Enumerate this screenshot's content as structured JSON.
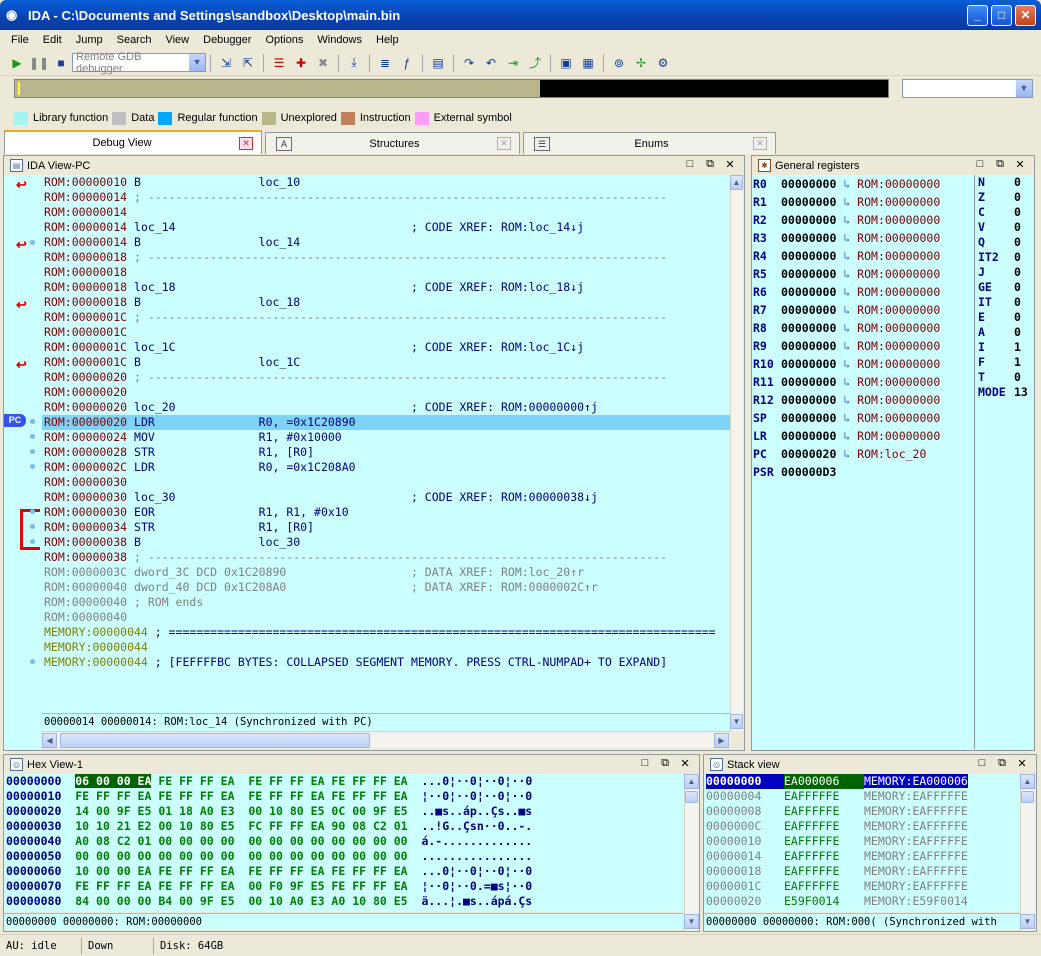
{
  "window": {
    "title": "IDA - C:\\Documents and Settings\\sandbox\\Desktop\\main.bin"
  },
  "menu": [
    "File",
    "Edit",
    "Jump",
    "Search",
    "View",
    "Debugger",
    "Options",
    "Windows",
    "Help"
  ],
  "toolbar": {
    "debugger_combo": "Remote GDB debugger"
  },
  "legend": [
    {
      "label": "Library function",
      "color": "#a6f3f3"
    },
    {
      "label": "Data",
      "color": "#c0c0c0"
    },
    {
      "label": "Regular function",
      "color": "#00a8ff"
    },
    {
      "label": "Unexplored",
      "color": "#b8b68a"
    },
    {
      "label": "Instruction",
      "color": "#c0805a"
    },
    {
      "label": "External symbol",
      "color": "#ff9cf5"
    }
  ],
  "tabs": [
    {
      "label": "Debug View"
    },
    {
      "label": "Structures"
    },
    {
      "label": "Enums"
    }
  ],
  "ida_view": {
    "title": "IDA View-PC",
    "pc_label": "PC",
    "sync_text": "00000014 00000014: ROM:loc_14 (Synchronized with PC)",
    "lines": [
      {
        "addr": "ROM:00000010",
        "text": " B                 loc_10",
        "kind": "code"
      },
      {
        "addr": "ROM:00000014",
        "text": " ; ---------------------------------------------------------------------------",
        "kind": "sep"
      },
      {
        "addr": "ROM:00000014",
        "text": "",
        "kind": "code"
      },
      {
        "addr": "ROM:00000014",
        "text": " loc_14                                  ; CODE XREF: ROM:loc_14↓j",
        "kind": "label"
      },
      {
        "addr": "ROM:00000014",
        "text": " B                 loc_14",
        "kind": "code"
      },
      {
        "addr": "ROM:00000018",
        "text": " ; ---------------------------------------------------------------------------",
        "kind": "sep"
      },
      {
        "addr": "ROM:00000018",
        "text": "",
        "kind": "code"
      },
      {
        "addr": "ROM:00000018",
        "text": " loc_18                                  ; CODE XREF: ROM:loc_18↓j",
        "kind": "label"
      },
      {
        "addr": "ROM:00000018",
        "text": " B                 loc_18",
        "kind": "code"
      },
      {
        "addr": "ROM:0000001C",
        "text": " ; ---------------------------------------------------------------------------",
        "kind": "sep"
      },
      {
        "addr": "ROM:0000001C",
        "text": "",
        "kind": "code"
      },
      {
        "addr": "ROM:0000001C",
        "text": " loc_1C                                  ; CODE XREF: ROM:loc_1C↓j",
        "kind": "label"
      },
      {
        "addr": "ROM:0000001C",
        "text": " B                 loc_1C",
        "kind": "code"
      },
      {
        "addr": "ROM:00000020",
        "text": " ; ---------------------------------------------------------------------------",
        "kind": "sep"
      },
      {
        "addr": "ROM:00000020",
        "text": "",
        "kind": "code"
      },
      {
        "addr": "ROM:00000020",
        "text": " loc_20                                  ; CODE XREF: ROM:00000000↑j",
        "kind": "label"
      },
      {
        "addr": "ROM:00000020",
        "text": " LDR               R0, =0x1C20890",
        "kind": "hl"
      },
      {
        "addr": "ROM:00000024",
        "text": " MOV               R1, #0x10000",
        "kind": "code"
      },
      {
        "addr": "ROM:00000028",
        "text": " STR               R1, [R0]",
        "kind": "code"
      },
      {
        "addr": "ROM:0000002C",
        "text": " LDR               R0, =0x1C208A0",
        "kind": "code"
      },
      {
        "addr": "ROM:00000030",
        "text": "",
        "kind": "code"
      },
      {
        "addr": "ROM:00000030",
        "text": " loc_30                                  ; CODE XREF: ROM:00000038↓j",
        "kind": "label"
      },
      {
        "addr": "ROM:00000030",
        "text": " EOR               R1, R1, #0x10",
        "kind": "code"
      },
      {
        "addr": "ROM:00000034",
        "text": " STR               R1, [R0]",
        "kind": "code"
      },
      {
        "addr": "ROM:00000038",
        "text": " B                 loc_30",
        "kind": "code"
      },
      {
        "addr": "ROM:00000038",
        "text": " ; ---------------------------------------------------------------------------",
        "kind": "sep"
      },
      {
        "addr": "ROM:0000003C",
        "text": " dword_3C DCD 0x1C20890                  ; DATA XREF: ROM:loc_20↑r",
        "kind": "data"
      },
      {
        "addr": "ROM:00000040",
        "text": " dword_40 DCD 0x1C208A0                  ; DATA XREF: ROM:0000002C↑r",
        "kind": "data"
      },
      {
        "addr": "ROM:00000040",
        "text": " ; ROM ends",
        "kind": "data"
      },
      {
        "addr": "ROM:00000040",
        "text": "",
        "kind": "data"
      },
      {
        "addr": "MEMORY:00000044",
        "text": " ; ===============================================================================",
        "kind": "mem"
      },
      {
        "addr": "MEMORY:00000044",
        "text": "",
        "kind": "mem"
      },
      {
        "addr": "MEMORY:00000044",
        "text": " ; [FEFFFFBC BYTES: COLLAPSED SEGMENT MEMORY. PRESS CTRL-NUMPAD+ TO EXPAND]",
        "kind": "mem"
      }
    ]
  },
  "registers": {
    "title": "General registers",
    "rows": [
      {
        "name": "R0",
        "value": "00000000",
        "target": "ROM:00000000"
      },
      {
        "name": "R1",
        "value": "00000000",
        "target": "ROM:00000000"
      },
      {
        "name": "R2",
        "value": "00000000",
        "target": "ROM:00000000"
      },
      {
        "name": "R3",
        "value": "00000000",
        "target": "ROM:00000000"
      },
      {
        "name": "R4",
        "value": "00000000",
        "target": "ROM:00000000"
      },
      {
        "name": "R5",
        "value": "00000000",
        "target": "ROM:00000000"
      },
      {
        "name": "R6",
        "value": "00000000",
        "target": "ROM:00000000"
      },
      {
        "name": "R7",
        "value": "00000000",
        "target": "ROM:00000000"
      },
      {
        "name": "R8",
        "value": "00000000",
        "target": "ROM:00000000"
      },
      {
        "name": "R9",
        "value": "00000000",
        "target": "ROM:00000000"
      },
      {
        "name": "R10",
        "value": "00000000",
        "target": "ROM:00000000"
      },
      {
        "name": "R11",
        "value": "00000000",
        "target": "ROM:00000000"
      },
      {
        "name": "R12",
        "value": "00000000",
        "target": "ROM:00000000"
      },
      {
        "name": "SP",
        "value": "00000000",
        "target": "ROM:00000000"
      },
      {
        "name": "LR",
        "value": "00000000",
        "target": "ROM:00000000"
      },
      {
        "name": "PC",
        "value": "00000020",
        "target": "ROM:loc_20"
      },
      {
        "name": "PSR",
        "value": "000000D3",
        "target": ""
      }
    ],
    "flags": [
      {
        "name": "N",
        "value": "0"
      },
      {
        "name": "Z",
        "value": "0"
      },
      {
        "name": "C",
        "value": "0"
      },
      {
        "name": "V",
        "value": "0"
      },
      {
        "name": "Q",
        "value": "0"
      },
      {
        "name": "IT2",
        "value": "0"
      },
      {
        "name": "J",
        "value": "0"
      },
      {
        "name": "GE",
        "value": "0"
      },
      {
        "name": "IT",
        "value": "0"
      },
      {
        "name": "E",
        "value": "0"
      },
      {
        "name": "A",
        "value": "0"
      },
      {
        "name": "I",
        "value": "1"
      },
      {
        "name": "F",
        "value": "1"
      },
      {
        "name": "T",
        "value": "0"
      },
      {
        "name": "MODE",
        "value": "13"
      }
    ]
  },
  "hex_view": {
    "title": "Hex View-1",
    "sync_text": "00000000 00000000: ROM:00000000",
    "rows": [
      {
        "addr": "00000000",
        "first": "06 00 00 EA",
        "bytes": " FE FF FF EA  FE FF FF EA FE FF FF EA",
        "ascii": "...0¦··0¦··0¦··0"
      },
      {
        "addr": "00000010",
        "first": "",
        "bytes": "FE FF FF EA FE FF FF EA  FE FF FF EA FE FF FF EA",
        "ascii": "¦··0¦··0¦··0¦··0"
      },
      {
        "addr": "00000020",
        "first": "",
        "bytes": "14 00 9F E5 01 18 A0 E3  00 10 80 E5 0C 00 9F E5",
        "ascii": "..■s..áp..Çs..■s"
      },
      {
        "addr": "00000030",
        "first": "",
        "bytes": "10 10 21 E2 00 10 80 E5  FC FF FF EA 90 08 C2 01",
        "ascii": "..!G..Çsn··0..-."
      },
      {
        "addr": "00000040",
        "first": "",
        "bytes": "A0 08 C2 01 00 00 00 00  00 00 00 00 00 00 00 00",
        "ascii": "á.-............."
      },
      {
        "addr": "00000050",
        "first": "",
        "bytes": "00 00 00 00 00 00 00 00  00 00 00 00 00 00 00 00",
        "ascii": "................"
      },
      {
        "addr": "00000060",
        "first": "",
        "bytes": "10 00 00 EA FE FF FF EA  FE FF FF EA FE FF FF EA",
        "ascii": "...0¦··0¦··0¦··0"
      },
      {
        "addr": "00000070",
        "first": "",
        "bytes": "FE FF FF EA FE FF FF EA  00 F0 9F E5 FE FF FF EA",
        "ascii": "¦··0¦··0.=■s¦··0"
      },
      {
        "addr": "00000080",
        "first": "",
        "bytes": "84 00 00 00 B4 00 9F E5  00 10 A0 E3 A0 10 80 E5",
        "ascii": "ä...¦.■s..ápá.Çs"
      }
    ]
  },
  "stack_view": {
    "title": "Stack view",
    "sync_text": "00000000 00000000: ROM:000( (Synchronized with",
    "rows": [
      {
        "addr": "00000000",
        "value": "EA000006",
        "target": "MEMORY:EA000006"
      },
      {
        "addr": "00000004",
        "value": "EAFFFFFE",
        "target": "MEMORY:EAFFFFFE"
      },
      {
        "addr": "00000008",
        "value": "EAFFFFFE",
        "target": "MEMORY:EAFFFFFE"
      },
      {
        "addr": "0000000C",
        "value": "EAFFFFFE",
        "target": "MEMORY:EAFFFFFE"
      },
      {
        "addr": "00000010",
        "value": "EAFFFFFE",
        "target": "MEMORY:EAFFFFFE"
      },
      {
        "addr": "00000014",
        "value": "EAFFFFFE",
        "target": "MEMORY:EAFFFFFE"
      },
      {
        "addr": "00000018",
        "value": "EAFFFFFE",
        "target": "MEMORY:EAFFFFFE"
      },
      {
        "addr": "0000001C",
        "value": "EAFFFFFE",
        "target": "MEMORY:EAFFFFFE"
      },
      {
        "addr": "00000020",
        "value": "E59F0014",
        "target": "MEMORY:E59F0014"
      }
    ]
  },
  "status": {
    "au": "AU:  idle",
    "state": "Down",
    "disk": "Disk: 64GB"
  }
}
